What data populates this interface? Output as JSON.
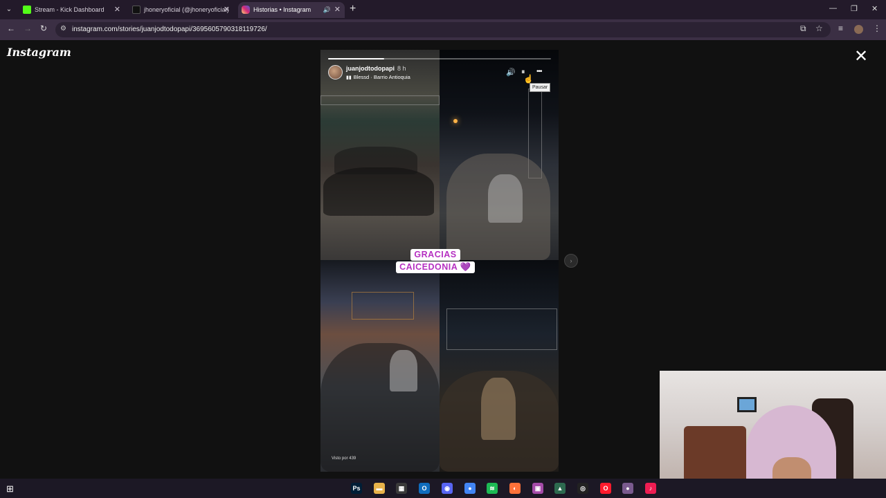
{
  "browser": {
    "tabs": [
      {
        "title": "Stream - Kick Dashboard",
        "favicon_color": "#53fc18",
        "active": false
      },
      {
        "title": "jhoneryoficial (@jhoneryoficial)",
        "favicon_color": "#111111",
        "active": false
      },
      {
        "title": "Historias • Instagram",
        "favicon_color": "#e1306c",
        "active": true
      }
    ],
    "new_tab_label": "+",
    "url": "instagram.com/stories/juanjodtodopapi/3695605790318119726/",
    "window_controls": [
      "—",
      "❐",
      "✕"
    ]
  },
  "instagram": {
    "logo": "Instagram",
    "close_label": "✕"
  },
  "story": {
    "username": "juanjodtodopapi",
    "time_ago": "8 h",
    "music": "Blessd · Barrio Antioquia",
    "progress_fraction": 0.25,
    "sticker_lines": [
      "GRACIAS",
      "CAICEDONIA 💜"
    ],
    "tooltip": "Pausar",
    "seen_by": "Visto por 439",
    "controls": {
      "mute": "🔊",
      "pause": "⏸",
      "more": "•••"
    },
    "next_label": "›"
  },
  "taskbar": {
    "start": "⊞",
    "apps": [
      {
        "label": "Ps",
        "color": "#001e36",
        "name": "photoshop-icon"
      },
      {
        "label": "▬",
        "color": "#e8b34a",
        "name": "file-explorer-icon"
      },
      {
        "label": "▦",
        "color": "#3a3a3a",
        "name": "calculator-icon"
      },
      {
        "label": "O",
        "color": "#0f6cbd",
        "name": "outlook-icon"
      },
      {
        "label": "◉",
        "color": "#5865f2",
        "name": "discord-icon"
      },
      {
        "label": "●",
        "color": "#4285f4",
        "name": "chrome-icon"
      },
      {
        "label": "≋",
        "color": "#1db954",
        "name": "spotify-icon"
      },
      {
        "label": "◐",
        "color": "#ff7139",
        "name": "firefox-icon"
      },
      {
        "label": "▣",
        "color": "#a44ba8",
        "name": "app-icon"
      },
      {
        "label": "▲",
        "color": "#2d6a4f",
        "name": "app2-icon"
      },
      {
        "label": "◎",
        "color": "#222222",
        "name": "obs-icon"
      },
      {
        "label": "O",
        "color": "#ff1b2d",
        "name": "opera-icon"
      },
      {
        "label": "●",
        "color": "#7a5a8e",
        "name": "chrome-active-icon"
      },
      {
        "label": "♪",
        "color": "#ee1d52",
        "name": "tiktok-icon"
      }
    ]
  }
}
